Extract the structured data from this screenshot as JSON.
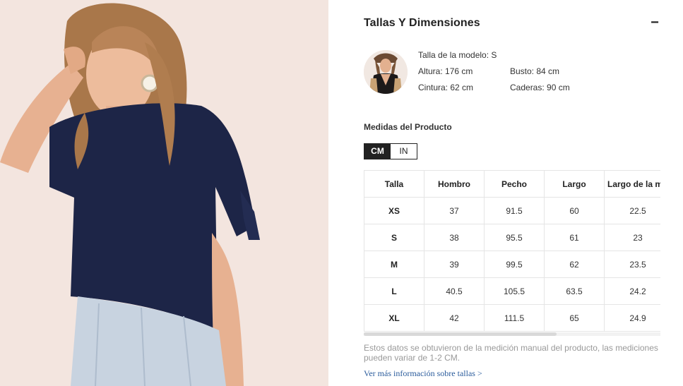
{
  "photo": {
    "alt": "product-photo"
  },
  "panel": {
    "title": "Tallas Y Dimensiones",
    "collapse_label": "−"
  },
  "model": {
    "size": "Talla de la modelo: S",
    "height": "Altura: 176 cm",
    "bust": "Busto: 84 cm",
    "waist": "Cintura: 62 cm",
    "hips": "Caderas: 90 cm"
  },
  "measures": {
    "title": "Medidas del Producto",
    "units": [
      {
        "label": "CM",
        "active": true
      },
      {
        "label": "IN",
        "active": false
      }
    ]
  },
  "table": {
    "headers": [
      "Talla",
      "Hombro",
      "Pecho",
      "Largo",
      "Largo de la m"
    ],
    "rows": [
      [
        "XS",
        "37",
        "91.5",
        "60",
        "22.5"
      ],
      [
        "S",
        "38",
        "95.5",
        "61",
        "23"
      ],
      [
        "M",
        "39",
        "99.5",
        "62",
        "23.5"
      ],
      [
        "L",
        "40.5",
        "105.5",
        "63.5",
        "24.2"
      ],
      [
        "XL",
        "42",
        "111.5",
        "65",
        "24.9"
      ]
    ]
  },
  "footer": {
    "disclaimer": "Estos datos se obtuvieron de la medición manual del producto, las mediciones pueden variar de 1-2 CM.",
    "link": "Ver más información sobre tallas >"
  },
  "colors": {
    "top_navy": "#1d2547",
    "background_pink": "#f3e5df",
    "link_blue": "#2b5c9c",
    "toggle_active": "#222222"
  }
}
